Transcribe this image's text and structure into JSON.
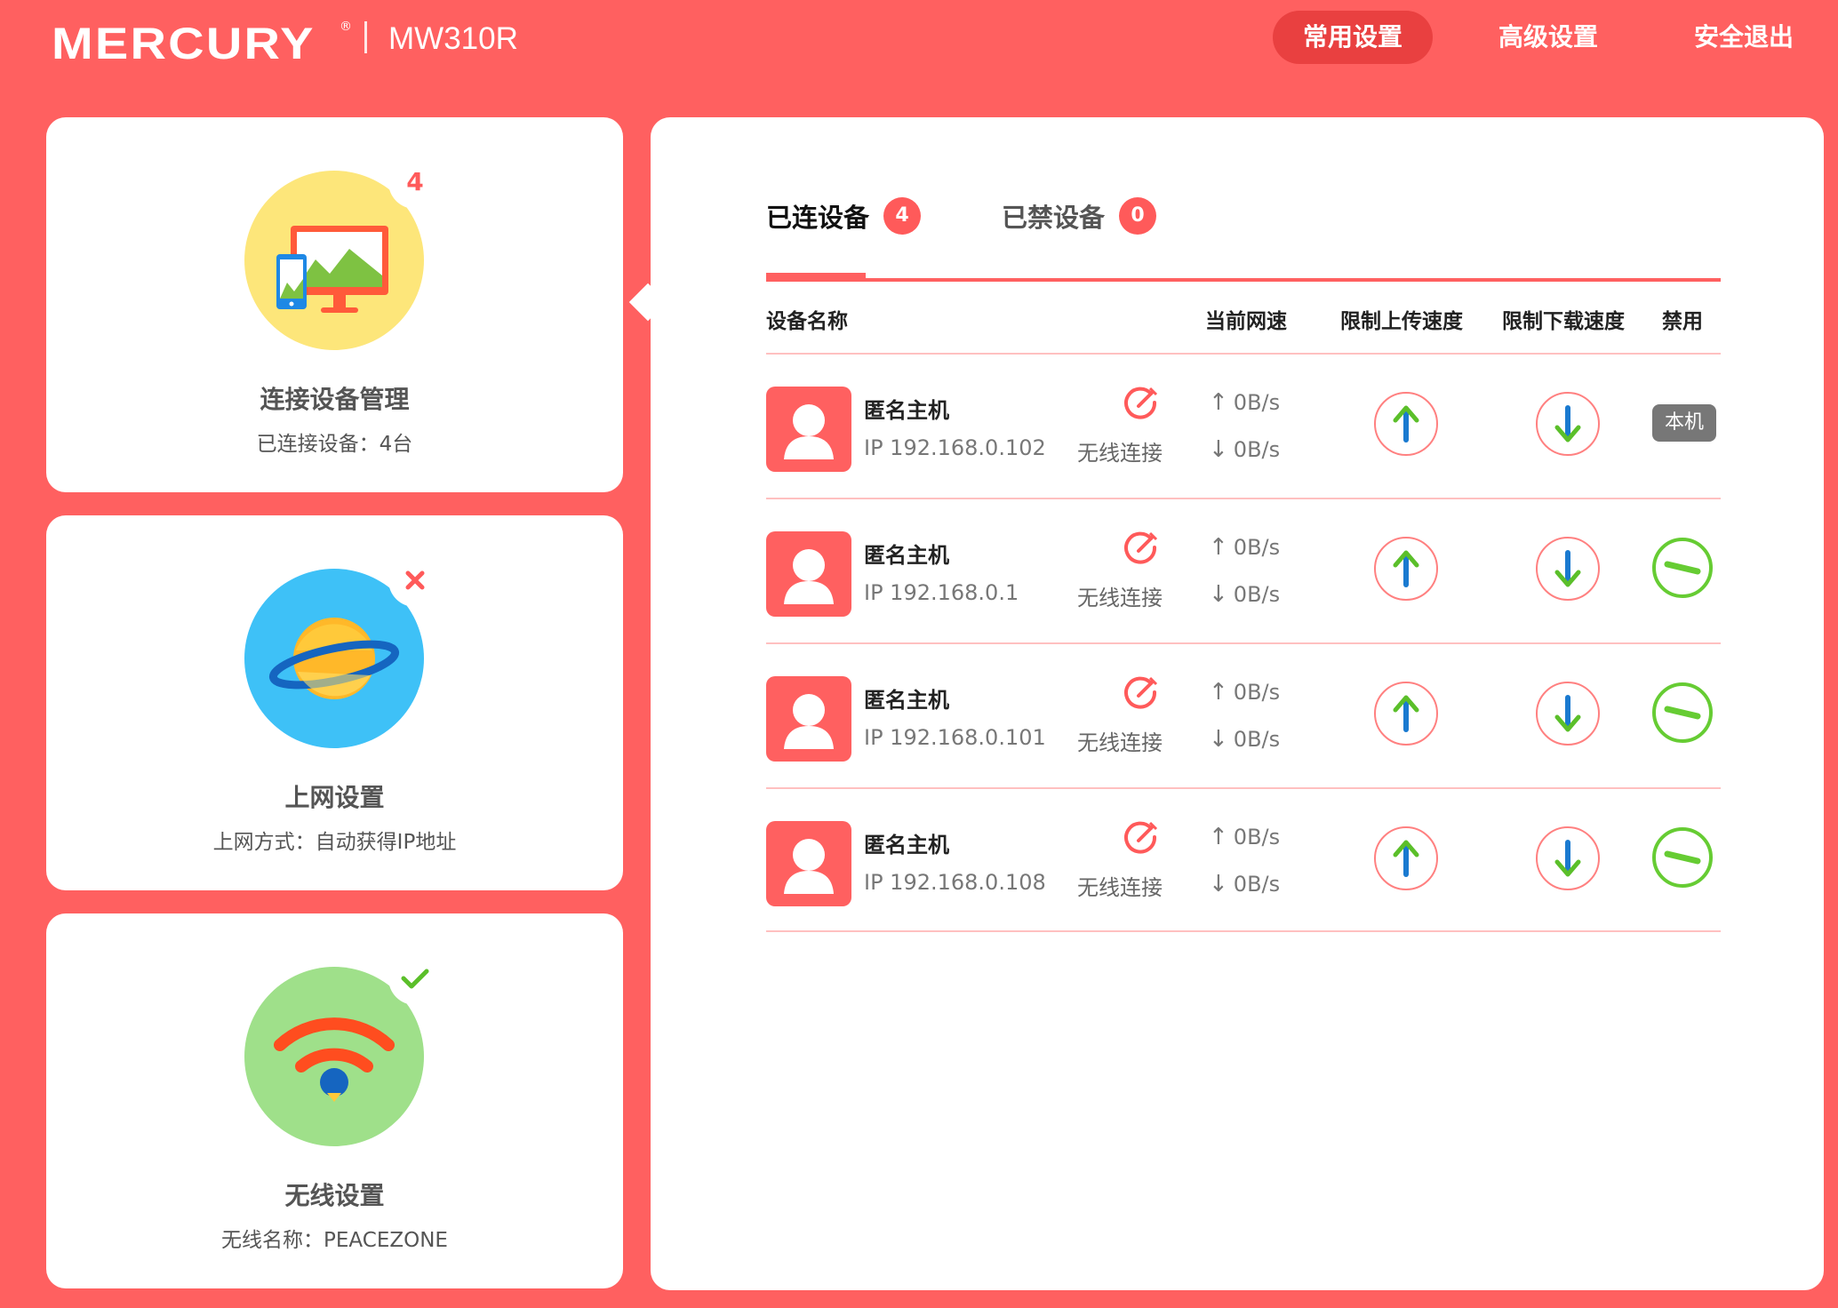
{
  "header": {
    "logo_text": "MERCURY",
    "logo_reg": "®",
    "model": "MW310R",
    "nav": [
      {
        "label": "常用设置",
        "active": true
      },
      {
        "label": "高级设置",
        "active": false
      },
      {
        "label": "安全退出",
        "active": false
      }
    ]
  },
  "sidebar": {
    "cards": [
      {
        "title": "连接设备管理",
        "subtitle": "已连接设备：4台",
        "badge": "4",
        "icon": "devices-icon",
        "badge_icon": "count-badge"
      },
      {
        "title": "上网设置",
        "subtitle": "上网方式：自动获得IP地址",
        "icon": "planet-icon",
        "badge_icon": "error-x-icon"
      },
      {
        "title": "无线设置",
        "subtitle": "无线名称：PEACEZONE",
        "icon": "wifi-icon",
        "badge_icon": "check-icon"
      }
    ]
  },
  "main": {
    "tabs": [
      {
        "label": "已连设备",
        "count": "4",
        "active": true
      },
      {
        "label": "已禁设备",
        "count": "0",
        "active": false
      }
    ],
    "columns": [
      "设备名称",
      "当前网速",
      "限制上传速度",
      "限制下载速度",
      "禁用"
    ],
    "devices": [
      {
        "name": "匿名主机",
        "ip": "IP 192.168.0.102",
        "conn": "无线连接",
        "up": "0B/s",
        "down": "0B/s",
        "self_label": "本机"
      },
      {
        "name": "匿名主机",
        "ip": "IP 192.168.0.1",
        "conn": "无线连接",
        "up": "0B/s",
        "down": "0B/s"
      },
      {
        "name": "匿名主机",
        "ip": "IP 192.168.0.101",
        "conn": "无线连接",
        "up": "0B/s",
        "down": "0B/s"
      },
      {
        "name": "匿名主机",
        "ip": "IP 192.168.0.108",
        "conn": "无线连接",
        "up": "0B/s",
        "down": "0B/s"
      }
    ],
    "arrows": {
      "up": "↑",
      "down": "↓"
    }
  },
  "colors": {
    "brand": "#ff6060",
    "nav_active": "#e94040",
    "ban_green": "#66cc33",
    "limit_blue": "#1a7ad0",
    "limit_green": "#5bbf2a"
  }
}
